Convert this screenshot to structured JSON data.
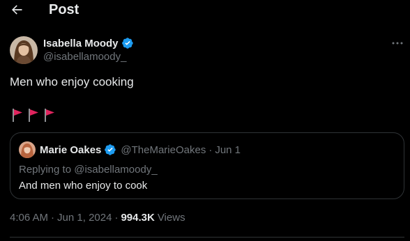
{
  "header": {
    "title": "Post",
    "back_icon": "arrow-left-icon"
  },
  "post": {
    "author": {
      "name": "Isabella Moody",
      "handle": "@isabellamoody_",
      "verified": true,
      "verified_color": "#1d9bf0"
    },
    "text": "Men who enjoy cooking",
    "emoji": [
      "red-flag",
      "red-flag",
      "red-flag"
    ],
    "more_icon": "more-horizontal-icon",
    "time": "4:06 AM",
    "date": "Jun 1, 2024",
    "views_count": "994.3K",
    "views_label": "Views"
  },
  "quote": {
    "author": {
      "name": "Marie Oakes",
      "handle": "@TheMarieOakes",
      "verified": true
    },
    "date": "Jun 1",
    "separator": "·",
    "replying_to": "Replying to @isabellamoody_",
    "text": "And men who enjoy to cook"
  },
  "colors": {
    "background": "#000000",
    "text_primary": "#e7e9ea",
    "text_secondary": "#71767b",
    "border": "#2f3336",
    "accent": "#1d9bf0",
    "flag_red": "#e0245e"
  }
}
